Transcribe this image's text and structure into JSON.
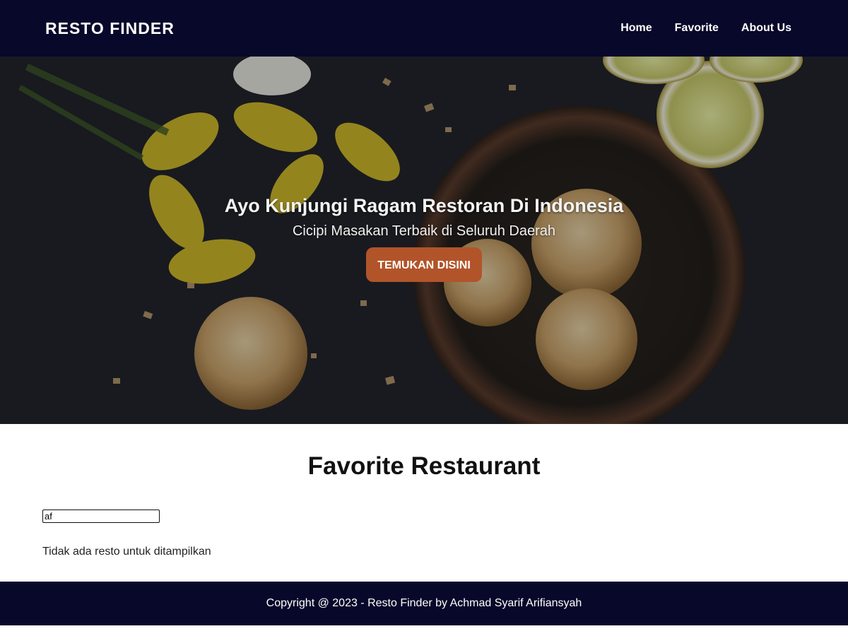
{
  "header": {
    "brand": "RESTO FINDER",
    "nav": [
      {
        "label": "Home"
      },
      {
        "label": "Favorite"
      },
      {
        "label": "About Us"
      }
    ]
  },
  "hero": {
    "title": "Ayo Kunjungi Ragam Restoran Di Indonesia",
    "subtitle": "Cicipi Masakan Terbaik di Seluruh Daerah",
    "button_label": "TEMUKAN DISINI",
    "accent_color": "#b2542a"
  },
  "main": {
    "title": "Favorite Restaurant",
    "search": {
      "value": "af",
      "placeholder": ""
    },
    "empty_message": "Tidak ada resto untuk ditampilkan"
  },
  "footer": {
    "text": "Copyright @ 2023 - Resto Finder by Achmad Syarif Arifiansyah"
  },
  "colors": {
    "navbar": "#07082a",
    "footer": "#07082a",
    "button": "#b2542a"
  }
}
